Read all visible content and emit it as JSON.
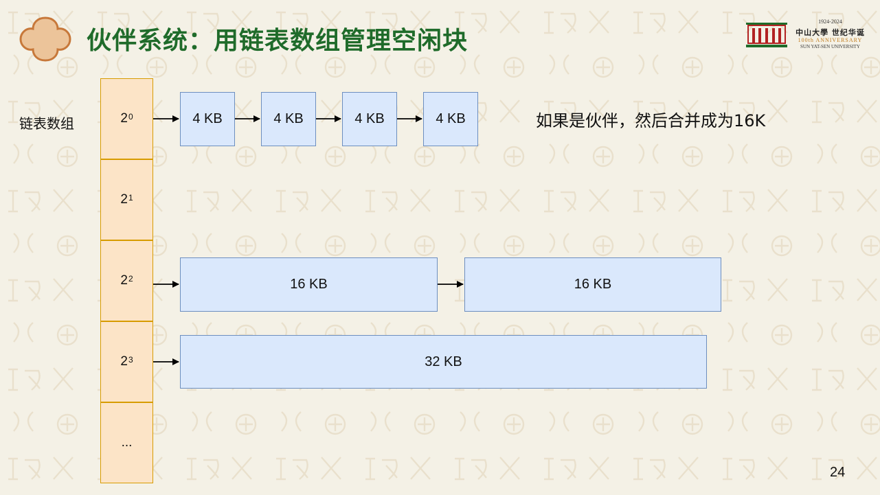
{
  "slide": {
    "title": "伙伴系统：用链表数组管理空闲块",
    "side_label": "链表数组",
    "note": "如果是伙伴，然后合并成为16K",
    "page_number": "24",
    "colors": {
      "title": "#1f6b2a",
      "array_fill": "#fce4c7",
      "array_border": "#d79b00",
      "block_fill": "#dae8fc",
      "block_border": "#6c8ebf",
      "background": "#f4f1e6"
    }
  },
  "logo": {
    "years": "1924-2024",
    "cn": "中山大學 世纪华诞",
    "anniversary": "100th ANNIVERSARY",
    "university": "SUN YAT-SEN UNIVERSITY"
  },
  "array_cells": [
    {
      "base": "2",
      "exp": "0"
    },
    {
      "base": "2",
      "exp": "1"
    },
    {
      "base": "2",
      "exp": "2"
    },
    {
      "base": "2",
      "exp": "3"
    },
    {
      "text": "..."
    }
  ],
  "lists": {
    "row0": [
      "4 KB",
      "4 KB",
      "4 KB",
      "4 KB"
    ],
    "row2": [
      "16 KB",
      "16 KB"
    ],
    "row3": [
      "32 KB"
    ]
  }
}
